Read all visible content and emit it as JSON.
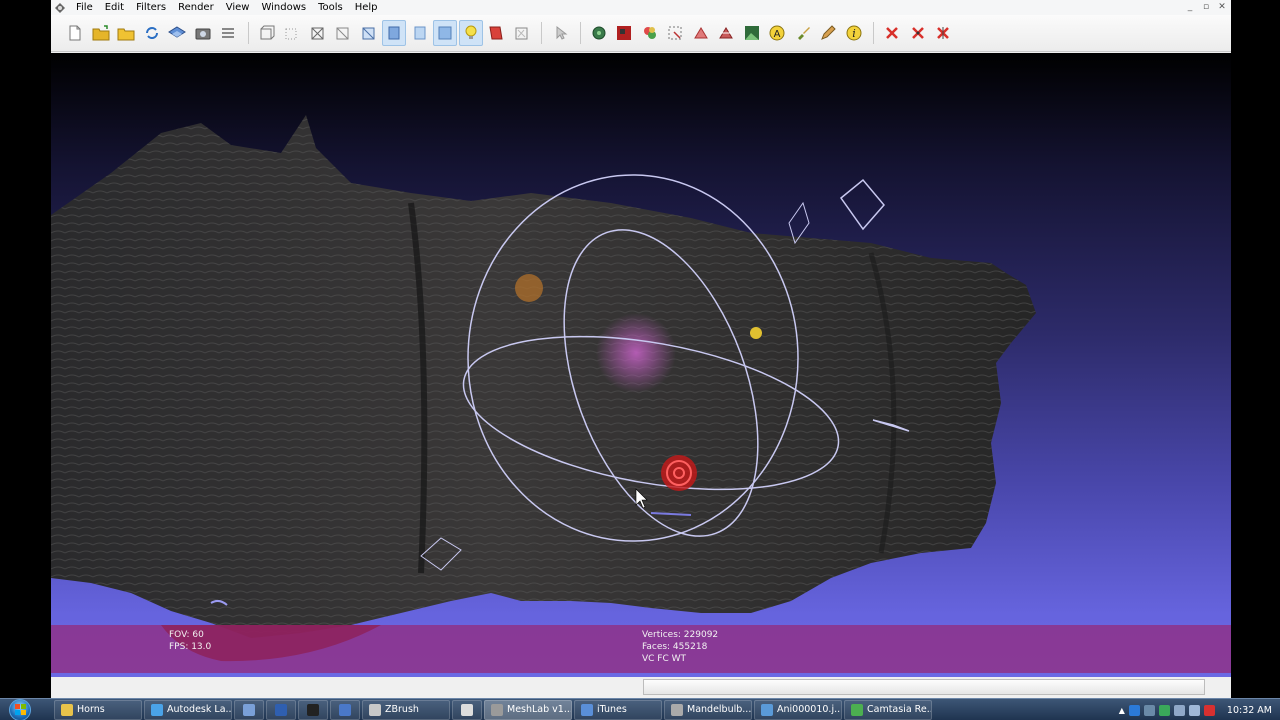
{
  "menu": [
    {
      "label": "File"
    },
    {
      "label": "Edit"
    },
    {
      "label": "Filters"
    },
    {
      "label": "Render"
    },
    {
      "label": "View"
    },
    {
      "label": "Windows"
    },
    {
      "label": "Tools"
    },
    {
      "label": "Help"
    }
  ],
  "window_controls": {
    "minimize": "_",
    "restore": "▫",
    "close": "✕"
  },
  "toolbar": {
    "groups": [
      [
        "new-document-icon",
        "open-folder-icon",
        "open-project-icon",
        "reload-icon",
        "save-layers-icon",
        "snapshot-icon",
        "layers-icon"
      ],
      [
        "bounding-box-icon",
        "points-icon",
        "wireframe-icon",
        "hidden-lines-icon",
        "flat-lines-icon",
        "flat-icon",
        "smooth-icon",
        "lighting-icon",
        "double-side-icon",
        "texture-icon"
      ],
      [
        "select-arrow-icon"
      ],
      [
        "manipulator-icon",
        "paint-texture-icon",
        "color-palette-icon",
        "select-faces-icon",
        "select-vertices-icon",
        "measure-icon",
        "raster-icon",
        "annotation-icon",
        "brush-icon",
        "pencil-icon",
        "info-icon"
      ],
      [
        "delete-faces-icon",
        "delete-vertices-icon",
        "delete-all-icon"
      ]
    ],
    "active": [
      "smooth-icon",
      "lighting-icon",
      "flat-icon"
    ]
  },
  "viewport": {
    "info_left": {
      "fov": "FOV: 60",
      "fps": "FPS:   13.0"
    },
    "info_right": {
      "vertices": "Vertices: 229092",
      "faces": "Faces: 455218",
      "modes": "VC FC WT"
    }
  },
  "taskbar": {
    "items": [
      {
        "label": "Horns",
        "color": "#e8c34a"
      },
      {
        "label": "Autodesk La...",
        "color": "#4aa3e8"
      },
      {
        "label": "",
        "color": "#7aa0d8",
        "small": true
      },
      {
        "label": "",
        "color": "#2f5fb0",
        "small": true
      },
      {
        "label": "",
        "color": "#222222",
        "small": true
      },
      {
        "label": "",
        "color": "#4a78c8",
        "small": true
      },
      {
        "label": "ZBrush",
        "color": "#c8c8c8"
      },
      {
        "label": "",
        "color": "#dddddd",
        "small": true
      },
      {
        "label": "MeshLab v1....",
        "color": "#9a9a9a",
        "active": true
      },
      {
        "label": "iTunes",
        "color": "#5a8fd8"
      },
      {
        "label": "Mandelbulb...",
        "color": "#aaaaaa"
      },
      {
        "label": "Ani000010.j...",
        "color": "#5a9ad8"
      },
      {
        "label": "Camtasia Re...",
        "color": "#4caf50"
      }
    ],
    "clock": "10:32 AM"
  }
}
